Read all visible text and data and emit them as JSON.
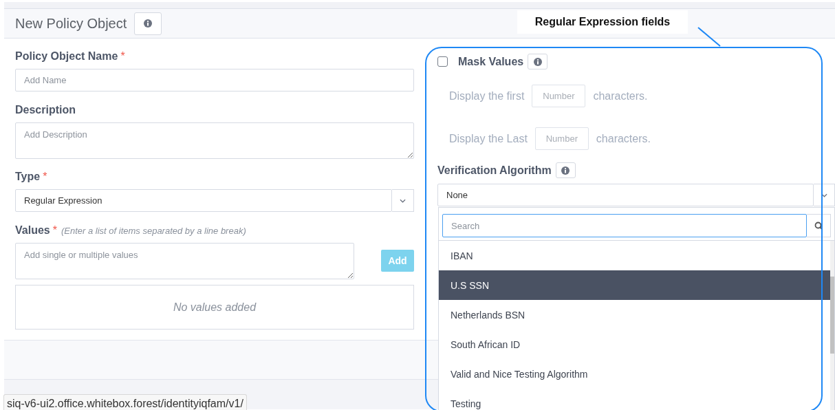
{
  "header": {
    "title": "New Policy Object"
  },
  "name_field": {
    "label": "Policy Object Name",
    "required_mark": "*",
    "placeholder": "Add Name"
  },
  "description_field": {
    "label": "Description",
    "placeholder": "Add Description"
  },
  "type_field": {
    "label": "Type",
    "required_mark": "*",
    "value": "Regular Expression"
  },
  "values_field": {
    "label": "Values",
    "required_mark": "*",
    "hint": "(Enter a list of items separated by a line break)",
    "placeholder": "Add single or multiple values",
    "add_button": {
      "label": "Add",
      "disabled": true
    },
    "empty_message": "No values added"
  },
  "mask_values": {
    "label": "Mask Values",
    "checked": false,
    "rows": [
      {
        "prefix": "Display the first",
        "placeholder": "Number",
        "suffix": "characters.",
        "disabled": true
      },
      {
        "prefix": "Display the Last",
        "placeholder": "Number",
        "suffix": "characters.",
        "disabled": true
      }
    ]
  },
  "verification_algorithm": {
    "label": "Verification Algorithm",
    "value": "None",
    "dropdown": {
      "search_placeholder": "Search",
      "options": [
        {
          "label": "IBAN",
          "selected": false
        },
        {
          "label": "U.S SSN",
          "selected": true
        },
        {
          "label": "Netherlands BSN",
          "selected": false
        },
        {
          "label": "South African ID",
          "selected": false
        },
        {
          "label": "Valid and Nice Testing Algorithm",
          "selected": false
        },
        {
          "label": "Testing",
          "selected": false
        }
      ]
    }
  },
  "annotation": {
    "label": "Regular Expression fields"
  },
  "status_url": "siq-v6-ui2.office.whitebox.forest/identityiqfam/v1/"
}
